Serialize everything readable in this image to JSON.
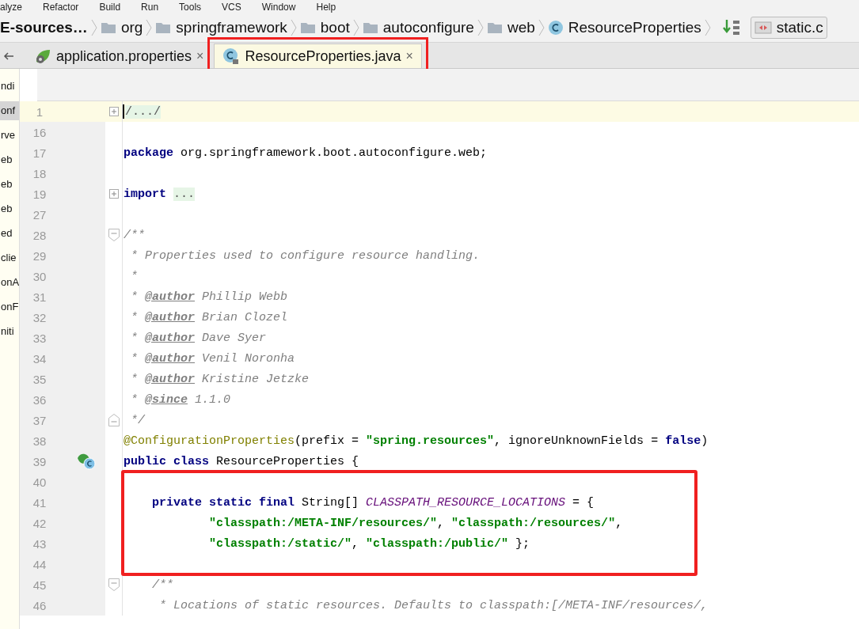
{
  "menu": [
    "alyze",
    "Refactor",
    "Build",
    "Run",
    "Tools",
    "VCS",
    "Window",
    "Help"
  ],
  "breadcrumbs": [
    {
      "kind": "project",
      "label": "E-sources…"
    },
    {
      "kind": "folder",
      "label": "org"
    },
    {
      "kind": "folder",
      "label": "springframework"
    },
    {
      "kind": "folder",
      "label": "boot"
    },
    {
      "kind": "folder",
      "label": "autoconfigure"
    },
    {
      "kind": "folder",
      "label": "web"
    },
    {
      "kind": "class",
      "label": "ResourceProperties"
    }
  ],
  "run_config": {
    "label": "static.c"
  },
  "tabs": [
    {
      "label": "application.properties",
      "selected": false,
      "boxed": false,
      "close": "×"
    },
    {
      "label": "ResourceProperties.java",
      "selected": true,
      "boxed": true,
      "close": "×"
    }
  ],
  "sidebar": {
    "items": [
      {
        "label": "ndi",
        "selected": false
      },
      {
        "label": "onf",
        "selected": true
      },
      {
        "label": "rve",
        "selected": false
      },
      {
        "label": "eb",
        "selected": false
      },
      {
        "label": "eb",
        "selected": false
      },
      {
        "label": "eb",
        "selected": false
      },
      {
        "label": "ed",
        "selected": false
      },
      {
        "label": "clie",
        "selected": false
      },
      {
        "label": "onA",
        "selected": false
      },
      {
        "label": "onF",
        "selected": false
      },
      {
        "label": "niti",
        "selected": false
      }
    ]
  },
  "editor": {
    "lines": [
      {
        "number": "1",
        "kind": "folded",
        "current": true,
        "tokens": [
          {
            "kind": "folded",
            "text": "/.../"
          }
        ]
      },
      {
        "number": "16",
        "kind": "code"
      },
      {
        "number": "17",
        "kind": "code",
        "tokens": [
          {
            "kind": "keyword",
            "text": "package"
          },
          {
            "kind": "plain",
            "text": " org.springframework.boot.autoconfigure.web;"
          }
        ]
      },
      {
        "number": "18",
        "kind": "code"
      },
      {
        "number": "19",
        "kind": "folded",
        "tokens": [
          {
            "kind": "keyword",
            "text": "import "
          },
          {
            "kind": "folded",
            "text": "..."
          }
        ]
      },
      {
        "number": "27",
        "kind": "code"
      },
      {
        "number": "28",
        "kind": "fold_start",
        "tokens": [
          {
            "kind": "comment",
            "text": "/**"
          }
        ]
      },
      {
        "number": "29",
        "kind": "code",
        "tokens": [
          {
            "kind": "comment",
            "text": " * Properties used to configure resource handling."
          }
        ]
      },
      {
        "number": "30",
        "kind": "code",
        "tokens": [
          {
            "kind": "comment",
            "text": " *"
          }
        ]
      },
      {
        "number": "31",
        "kind": "code",
        "tokens": [
          {
            "kind": "comment",
            "text": " * "
          },
          {
            "kind": "doctag",
            "text": "@author"
          },
          {
            "kind": "comment",
            "text": " Phillip Webb"
          }
        ]
      },
      {
        "number": "32",
        "kind": "code",
        "tokens": [
          {
            "kind": "comment",
            "text": " * "
          },
          {
            "kind": "doctag",
            "text": "@author"
          },
          {
            "kind": "comment",
            "text": " Brian Clozel"
          }
        ]
      },
      {
        "number": "33",
        "kind": "code",
        "tokens": [
          {
            "kind": "comment",
            "text": " * "
          },
          {
            "kind": "doctag",
            "text": "@author"
          },
          {
            "kind": "comment",
            "text": " Dave Syer"
          }
        ]
      },
      {
        "number": "34",
        "kind": "code",
        "tokens": [
          {
            "kind": "comment",
            "text": " * "
          },
          {
            "kind": "doctag",
            "text": "@author"
          },
          {
            "kind": "comment",
            "text": " Venil Noronha"
          }
        ]
      },
      {
        "number": "35",
        "kind": "code",
        "tokens": [
          {
            "kind": "comment",
            "text": " * "
          },
          {
            "kind": "doctag",
            "text": "@author"
          },
          {
            "kind": "comment",
            "text": " Kristine Jetzke"
          }
        ]
      },
      {
        "number": "36",
        "kind": "code",
        "tokens": [
          {
            "kind": "comment",
            "text": " * "
          },
          {
            "kind": "doctag",
            "text": "@since"
          },
          {
            "kind": "comment",
            "text": " 1.1.0"
          }
        ]
      },
      {
        "number": "37",
        "kind": "fold_end",
        "tokens": [
          {
            "kind": "comment",
            "text": " */"
          }
        ]
      },
      {
        "number": "38",
        "kind": "code",
        "tokens": [
          {
            "kind": "annotation",
            "text": "@ConfigurationProperties"
          },
          {
            "kind": "plain",
            "text": "(prefix = "
          },
          {
            "kind": "string",
            "text": "\"spring.resources\""
          },
          {
            "kind": "plain",
            "text": ", ignoreUnknownFields = "
          },
          {
            "kind": "keyword",
            "text": "false"
          },
          {
            "kind": "plain",
            "text": ")"
          }
        ]
      },
      {
        "number": "39",
        "kind": "bean",
        "tokens": [
          {
            "kind": "keyword",
            "text": "public class"
          },
          {
            "kind": "plain",
            "text": " ResourceProperties {"
          }
        ]
      },
      {
        "number": "40",
        "kind": "code",
        "boxed": true
      },
      {
        "number": "41",
        "kind": "code",
        "boxed": true,
        "tokens": [
          {
            "kind": "keyword",
            "text": "    private static final"
          },
          {
            "kind": "plain",
            "text": " String[] "
          },
          {
            "kind": "constant",
            "text": "CLASSPATH_RESOURCE_LOCATIONS"
          },
          {
            "kind": "plain",
            "text": " = {"
          }
        ]
      },
      {
        "number": "42",
        "kind": "code",
        "boxed": true,
        "tokens": [
          {
            "kind": "string",
            "text": "            \"classpath:/META-INF/resources/\""
          },
          {
            "kind": "plain",
            "text": ", "
          },
          {
            "kind": "string",
            "text": "\"classpath:/resources/\""
          },
          {
            "kind": "plain",
            "text": ","
          }
        ]
      },
      {
        "number": "43",
        "kind": "code",
        "boxed": true,
        "tokens": [
          {
            "kind": "string",
            "text": "            \"classpath:/static/\""
          },
          {
            "kind": "plain",
            "text": ", "
          },
          {
            "kind": "string",
            "text": "\"classpath:/public/\""
          },
          {
            "kind": "plain",
            "text": " };"
          }
        ]
      },
      {
        "number": "44",
        "kind": "code",
        "boxed": true
      },
      {
        "number": "45",
        "kind": "fold_start",
        "tokens": [
          {
            "kind": "comment",
            "text": "    /**"
          }
        ]
      },
      {
        "number": "46",
        "kind": "code",
        "tokens": [
          {
            "kind": "comment",
            "text": "     * Locations of static resources. Defaults to classpath:[/META-INF/resources/,"
          }
        ]
      }
    ]
  }
}
